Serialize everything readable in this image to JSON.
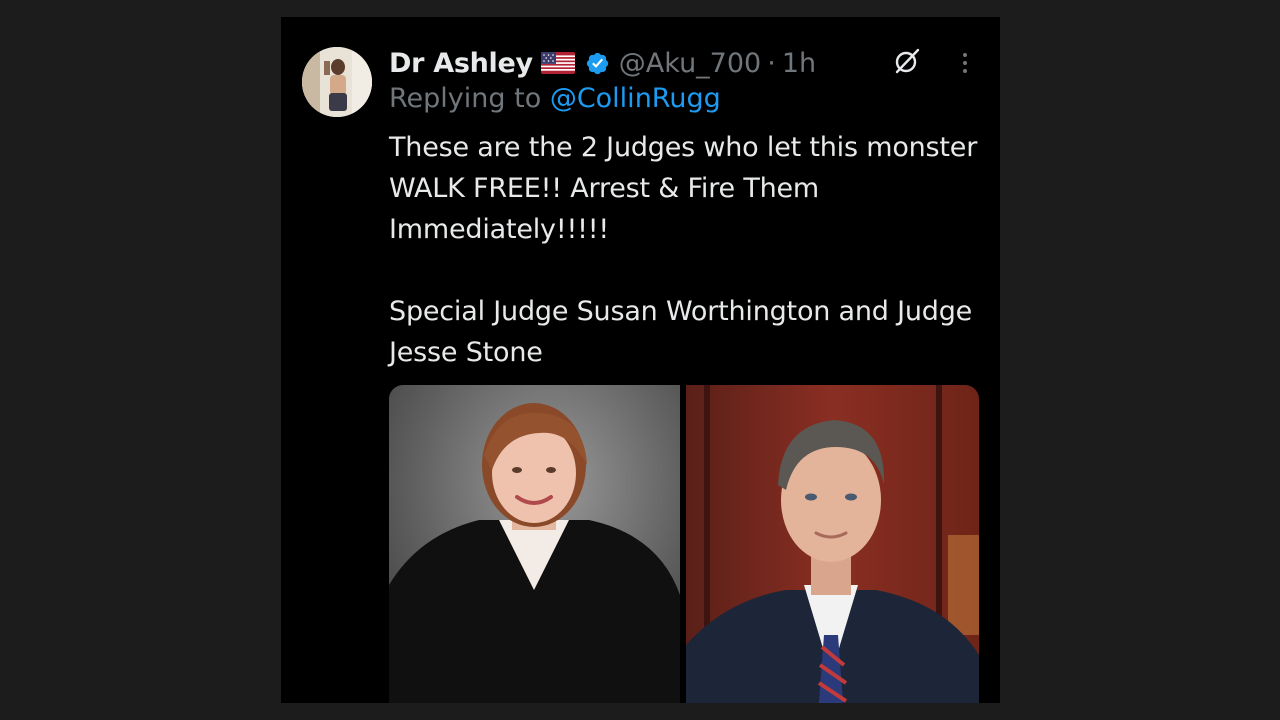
{
  "tweet": {
    "author_name": "Dr Ashley",
    "flag_emoji": "🇺🇸",
    "handle": "@Aku_700",
    "separator": "·",
    "time": "1h",
    "replying_prefix": "Replying to ",
    "replying_mention": "@CollinRugg",
    "text_lines": [
      "These are the 2 Judges who let this monster WALK FREE!! Arrest & Fire Them Immediately!!!!!",
      "Special Judge Susan Worthington and Judge Jesse Stone"
    ],
    "icons": {
      "verified": "verified-badge-icon",
      "grok": "grok-icon",
      "more": "more-options-icon",
      "flag": "us-flag-icon"
    },
    "colors": {
      "background": "#000000",
      "text": "#e7e9ea",
      "muted": "#71767b",
      "link": "#1d9bf0",
      "verified": "#1d9bf0"
    },
    "media": [
      "photo-woman-in-judicial-robe",
      "photo-man-in-suit"
    ]
  }
}
